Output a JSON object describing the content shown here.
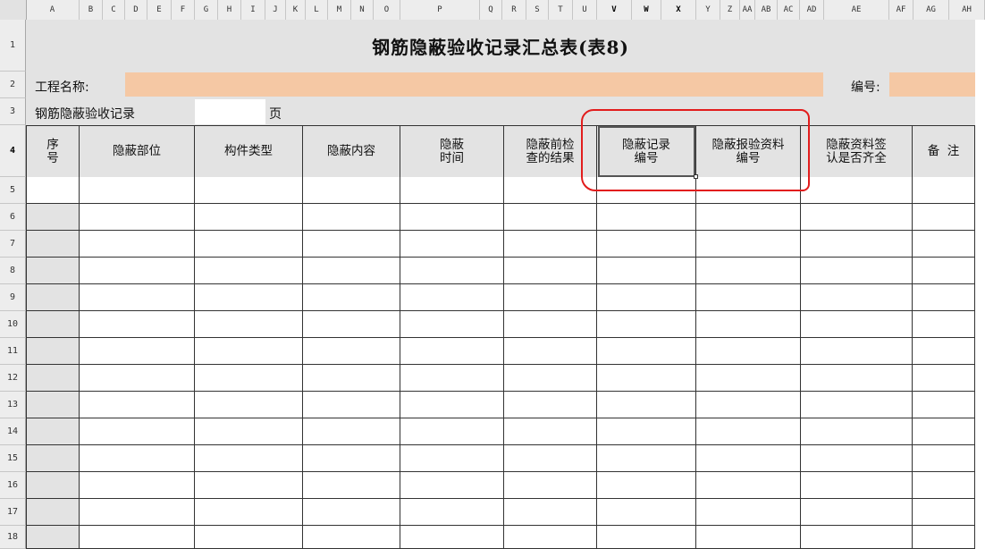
{
  "column_headers": [
    "A",
    "B",
    "C",
    "D",
    "E",
    "F",
    "G",
    "H",
    "I",
    "J",
    "K",
    "L",
    "M",
    "N",
    "O",
    "P",
    "Q",
    "R",
    "S",
    "T",
    "U",
    "V",
    "W",
    "X",
    "Y",
    "Z",
    "AA",
    "AB",
    "AC",
    "AD",
    "AE",
    "AF",
    "AG",
    "AH"
  ],
  "row_headers": [
    "1",
    "2",
    "3",
    "4",
    "5",
    "6",
    "7",
    "8",
    "9",
    "10",
    "11",
    "12",
    "13",
    "14",
    "15",
    "16",
    "17",
    "18"
  ],
  "sheet": {
    "title": "钢筋隐蔽验收记录汇总表(表8)",
    "project_name_label": "工程名称:",
    "project_name_value": "",
    "number_label": "编号:",
    "number_value": "",
    "record_label": "钢筋隐蔽验收记录",
    "page_value": "",
    "page_label": "页",
    "headers": [
      {
        "line1": "序",
        "line2": "号"
      },
      {
        "line1": "隐蔽部位",
        "line2": ""
      },
      {
        "line1": "构件类型",
        "line2": ""
      },
      {
        "line1": "隐蔽内容",
        "line2": ""
      },
      {
        "line1": "隐蔽",
        "line2": "时间"
      },
      {
        "line1": "隐蔽前检",
        "line2": "查的结果"
      },
      {
        "line1": "隐蔽记录",
        "line2": "编号"
      },
      {
        "line1": "隐蔽报验资料",
        "line2": "编号"
      },
      {
        "line1": "隐蔽资料签",
        "line2": "认是否齐全"
      },
      {
        "line1": "备  注",
        "line2": ""
      }
    ]
  },
  "selected_cell_header": "隐蔽记录编号",
  "colors": {
    "orange_fill": "#f5c8a4",
    "grey_fill": "#e3e3e3",
    "annotation_red": "#e21c1c"
  }
}
